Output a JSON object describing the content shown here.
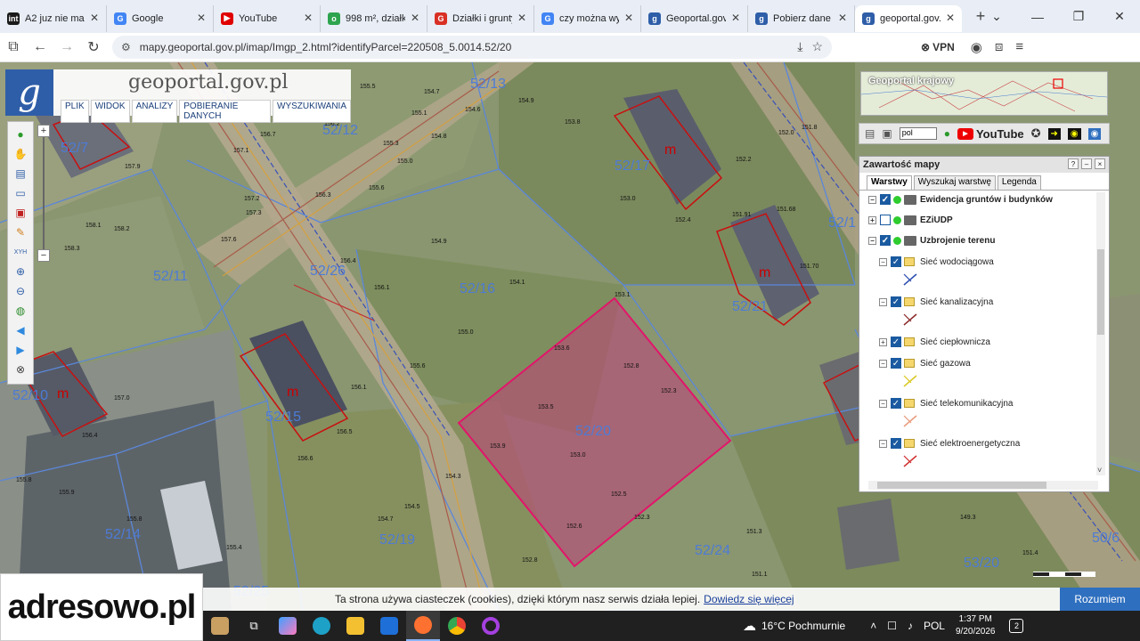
{
  "browser": {
    "tabs": [
      {
        "label": "A2 juz nie ma. El",
        "fav": "int",
        "color": "#1a1a1a"
      },
      {
        "label": "Google",
        "fav": "G",
        "color": "#4285f4"
      },
      {
        "label": "YouTube",
        "fav": "▶",
        "color": "#e00000"
      },
      {
        "label": "998 m², działka",
        "fav": "o",
        "color": "#2ea44f"
      },
      {
        "label": "Działki i grunty",
        "fav": "G",
        "color": "#d93025"
      },
      {
        "label": "czy można wyko",
        "fav": "G",
        "color": "#4285f4"
      },
      {
        "label": "Geoportal.gov.pl",
        "fav": "g",
        "color": "#2f5ea8"
      },
      {
        "label": "Pobierz dane - G",
        "fav": "g",
        "color": "#2f5ea8"
      },
      {
        "label": "geoportal.gov.pl",
        "fav": "g",
        "color": "#2f5ea8"
      }
    ],
    "url": "mapy.geoportal.gov.pl/imap/Imgp_2.html?identifyParcel=220508_5.0014.52/20",
    "vpn_label": "VPN"
  },
  "logo": {
    "title": "geoportal.gov.pl",
    "letter": "g"
  },
  "menu": [
    "PLIK",
    "WIDOK",
    "ANALIZY",
    "POBIERANIE DANYCH",
    "WYSZUKIWANIA"
  ],
  "tools": {
    "xyh": "XYH",
    "zoom_in": "+",
    "zoom_out": "−"
  },
  "geoportal_krajowy": {
    "title": "Geoportal krajowy",
    "lang": "pol",
    "youtube": "YouTube"
  },
  "layers_panel": {
    "title": "Zawartość mapy",
    "controls": [
      "?",
      "–",
      "×"
    ],
    "tabs": [
      "Warstwy",
      "Wyszukaj warstwę",
      "Legenda"
    ],
    "layers": [
      {
        "label": "Ewidencja gruntów i budynków",
        "level": 0,
        "checked": true,
        "bold": true,
        "dot": true
      },
      {
        "label": "EZiUDP",
        "level": 0,
        "checked": false,
        "bold": true,
        "dot": true
      },
      {
        "label": "Uzbrojenie terenu",
        "level": 0,
        "checked": true,
        "bold": true,
        "dot": true
      },
      {
        "label": "Sieć wodociągowa",
        "level": 1,
        "checked": true,
        "legend": "#2a4db0"
      },
      {
        "label": "Sieć kanalizacyjna",
        "level": 1,
        "checked": true,
        "legend": "#8b2a2a"
      },
      {
        "label": "Sieć ciepłownicza",
        "level": 1,
        "checked": true
      },
      {
        "label": "Sieć gazowa",
        "level": 1,
        "checked": true,
        "legend": "#d9c820"
      },
      {
        "label": "Sieć telekomunikacyjna",
        "level": 1,
        "checked": true,
        "legend": "#e89a7a"
      },
      {
        "label": "Sieć elektroenergetyczna",
        "level": 1,
        "checked": true,
        "legend": "#d03030"
      }
    ]
  },
  "map": {
    "parcel_labels": [
      "52/7",
      "52/12",
      "52/13",
      "52/17",
      "52/11",
      "52/26",
      "52/16",
      "52/21",
      "52/15",
      "52/10",
      "52/20",
      "52/14",
      "52/19",
      "52/24",
      "53/20",
      "52/1",
      "50/6",
      "52/25"
    ],
    "m_marker": "m",
    "selected_parcel": "52/20",
    "heights": [
      "155.5",
      "154.7",
      "155.1",
      "154.9",
      "154.6",
      "155.3",
      "155.0",
      "154.8",
      "155.6",
      "156.2",
      "156.3",
      "156.7",
      "157.1",
      "157.2",
      "157.3",
      "157.6",
      "157.9",
      "158.1",
      "158.2",
      "158.3",
      "154.1",
      "154.9",
      "153.6",
      "153.5",
      "153.9",
      "153.0",
      "152.8",
      "152.3",
      "152.5",
      "152.6",
      "153.1",
      "153.8",
      "153.0",
      "152.4",
      "151.3",
      "151.1",
      "151.8",
      "152.0",
      "151.68",
      "151.91",
      "151.70",
      "156.4",
      "156.1",
      "155.0",
      "155.6",
      "156.5",
      "156.6",
      "156.1",
      "157.0",
      "156.4",
      "155.8",
      "155.9",
      "155.8",
      "154.3",
      "154.7",
      "154.5",
      "155.4",
      "152.8",
      "151.4",
      "149.3",
      "152.2",
      "152.3"
    ]
  },
  "cookie": {
    "text": "Ta strona używa ciasteczek (cookies), dzięki którym nasz serwis działa lepiej.",
    "link": "Dowiedz się więcej",
    "button": "Rozumiem"
  },
  "ad": {
    "text": "adresowo.pl"
  },
  "taskbar": {
    "weather": "16°C Pochmurnie",
    "weather_badge": "3",
    "lang": "POL",
    "time": "1:37 PM",
    "date": "9/20/2026",
    "notifications": "2"
  }
}
